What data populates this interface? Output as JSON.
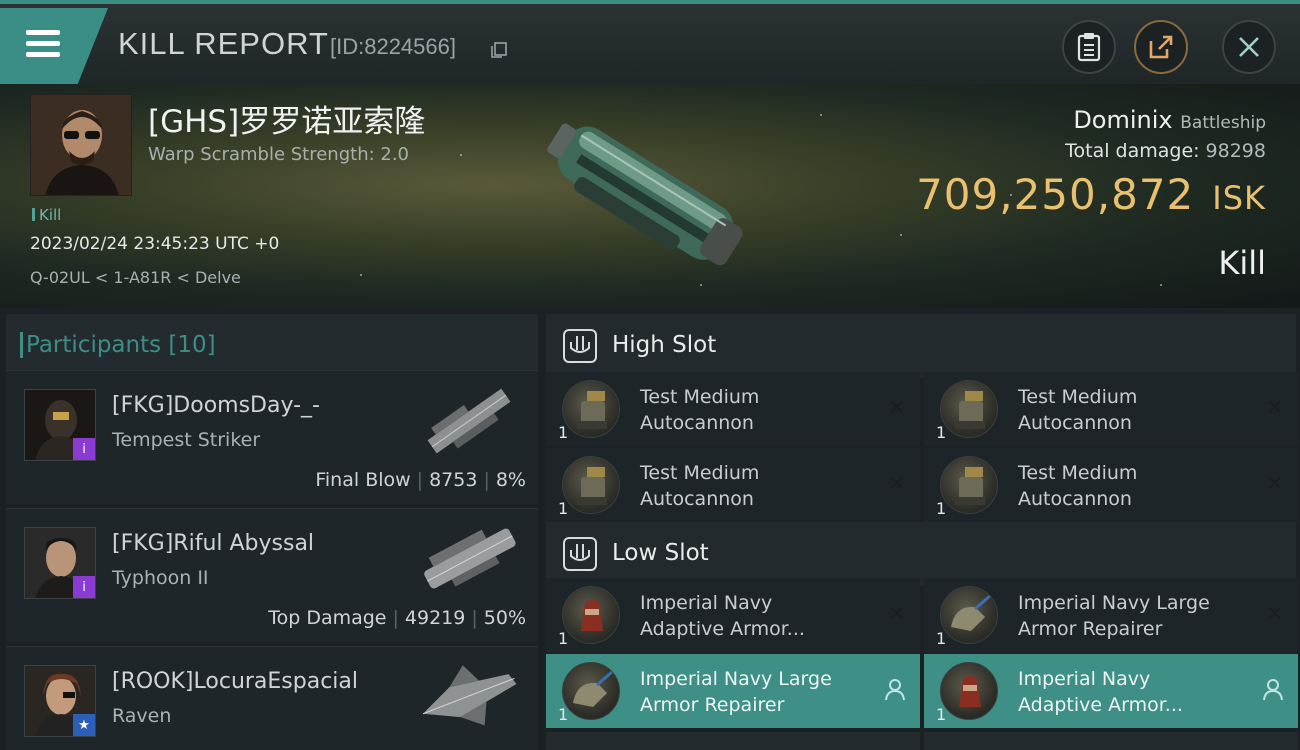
{
  "header": {
    "title": "KILL REPORT",
    "report_id": "[ID:8224566]"
  },
  "victim": {
    "name": "[GHS]罗罗诺亚索隆",
    "warp_scramble": "Warp Scramble Strength: 2.0",
    "tag": "Kill",
    "timestamp": "2023/02/24 23:45:23 UTC +0",
    "location": "Q-02UL < 1-A81R < Delve",
    "ship_name": "Dominix",
    "ship_class": "Battleship",
    "total_damage_label": "Total damage:",
    "total_damage": "98298",
    "isk_value": "709,250,872",
    "isk_unit": "ISK",
    "result": "Kill"
  },
  "participants": {
    "title": "Participants",
    "count": "[10]",
    "items": [
      {
        "name": "[FKG]DoomsDay-_-",
        "ship": "Tempest Striker",
        "role": "Final Blow",
        "damage": "8753",
        "percent": "8%",
        "badge": "i"
      },
      {
        "name": "[FKG]Riful Abyssal",
        "ship": "Typhoon II",
        "role": "Top Damage",
        "damage": "49219",
        "percent": "50%",
        "badge": "i"
      },
      {
        "name": "[ROOK]LocuraEspacial",
        "ship": "Raven",
        "role": "",
        "damage": "",
        "percent": "",
        "badge": "★"
      }
    ]
  },
  "fitting": {
    "high_slot": {
      "title": "High Slot",
      "modules": [
        {
          "line1": "Test Medium",
          "line2": "Autocannon",
          "qty": "1"
        },
        {
          "line1": "Test Medium",
          "line2": "Autocannon",
          "qty": "1"
        },
        {
          "line1": "Test Medium",
          "line2": "Autocannon",
          "qty": "1"
        },
        {
          "line1": "Test Medium",
          "line2": "Autocannon",
          "qty": "1"
        }
      ]
    },
    "low_slot": {
      "title": "Low Slot",
      "modules": [
        {
          "line1": "Imperial Navy",
          "line2": "Adaptive Armor...",
          "qty": "1"
        },
        {
          "line1": "Imperial Navy Large",
          "line2": "Armor Repairer",
          "qty": "1"
        },
        {
          "line1": "Imperial Navy Large",
          "line2": "Armor Repairer",
          "qty": "1"
        },
        {
          "line1": "Imperial Navy",
          "line2": "Adaptive Armor...",
          "qty": "1"
        }
      ]
    }
  },
  "colors": {
    "accent": "#3d8f86",
    "isk": "#e8c06e",
    "highlight_module": "#3e8f86"
  },
  "icons": [
    "menu-icon",
    "copy-icon",
    "clipboard-icon",
    "share-icon",
    "close-icon",
    "slot-icon",
    "destroyed-x-icon",
    "pilot-icon"
  ]
}
